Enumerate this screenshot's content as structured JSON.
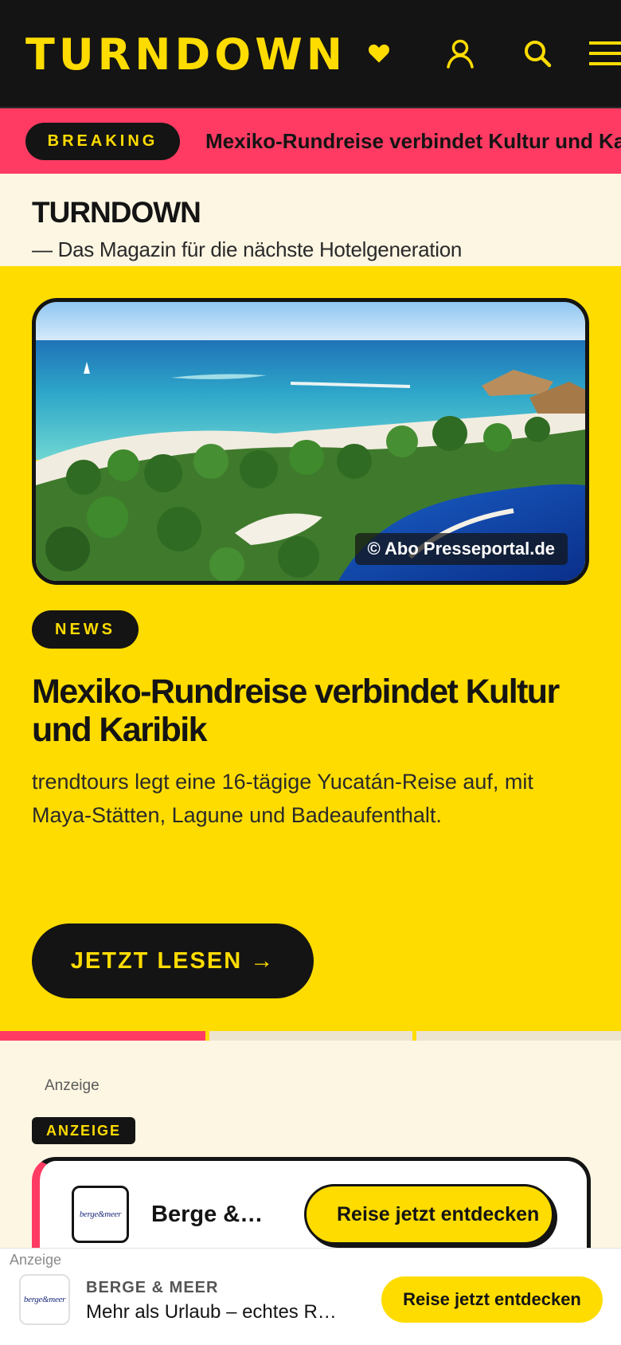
{
  "header": {
    "logo": "TURNDOWN",
    "icons": [
      "heart-icon",
      "user-icon",
      "search-icon",
      "menu-icon"
    ],
    "colors": {
      "background": "#141414",
      "accent": "#ffdc00"
    }
  },
  "breaking": {
    "label": "BREAKING",
    "text": "Mexiko-Rundreise verbindet Kultur und Karibik",
    "color": "#ff3b63"
  },
  "masthead": {
    "title": "TURNDOWN",
    "subtitle": "— Das Magazin für die nächste Hotelgeneration"
  },
  "hero": {
    "image_credit": "© Abo Presseportal.de",
    "category": "NEWS",
    "headline": "Mexiko-Rundreise verbindet Kultur und Karibik",
    "teaser": "trendtours legt eine 16-tägige Yucatán-Reise auf, mit Maya-Stätten, Lagune und Badeaufenthalt.",
    "cta": "JETZT LESEN →",
    "background": "#ffdc00"
  },
  "slider": {
    "slides": 3,
    "active": 1
  },
  "ad": {
    "label": "Anzeige",
    "badge": "ANZEIGE",
    "brand_short": "Berge & Meer",
    "logo_text": "berge&meer",
    "cta": "Reise jetzt entdecken"
  },
  "sticky_ad": {
    "label": "Anzeige",
    "brand": "BERGE & MEER",
    "title": "Mehr als Urlaub – echtes Reiseglück",
    "logo_text": "berge&meer",
    "cta": "Reise jetzt entdecken"
  }
}
